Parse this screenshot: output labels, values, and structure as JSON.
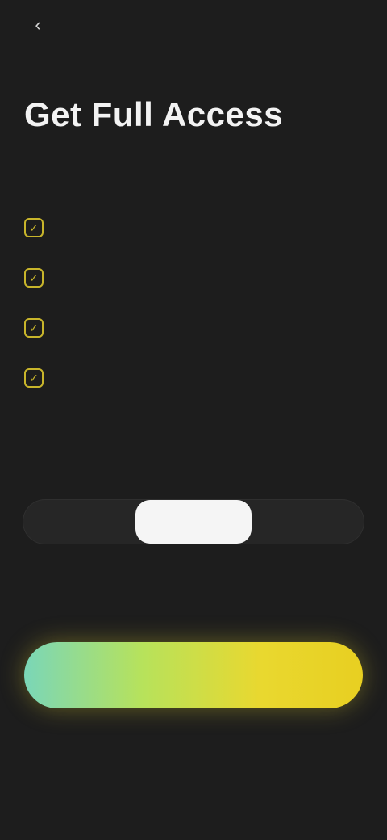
{
  "header": {
    "back_icon": "chevron-left-icon",
    "back_glyph": "‹",
    "app_label": "",
    "restore_label": ""
  },
  "title": "Get Full Access",
  "subtitle": "",
  "features": [
    {
      "icon": "check-icon",
      "glyph": "✓",
      "text": ""
    },
    {
      "icon": "check-icon",
      "glyph": "✓",
      "text": ""
    },
    {
      "icon": "check-icon",
      "glyph": "✓",
      "text": ""
    },
    {
      "icon": "check-icon",
      "glyph": "✓",
      "text": ""
    }
  ],
  "plans": {
    "left": "",
    "middle": "",
    "right": "",
    "selected": "middle"
  },
  "plan_note": "",
  "cta": {
    "label": ""
  },
  "legal": {
    "line1": "",
    "line2": "",
    "line3": ""
  },
  "colors": {
    "background": "#1d1d1d",
    "accent_yellow": "#e8cf21",
    "accent_green": "#7ad6b8",
    "feature_icon": "#c8b52b"
  }
}
